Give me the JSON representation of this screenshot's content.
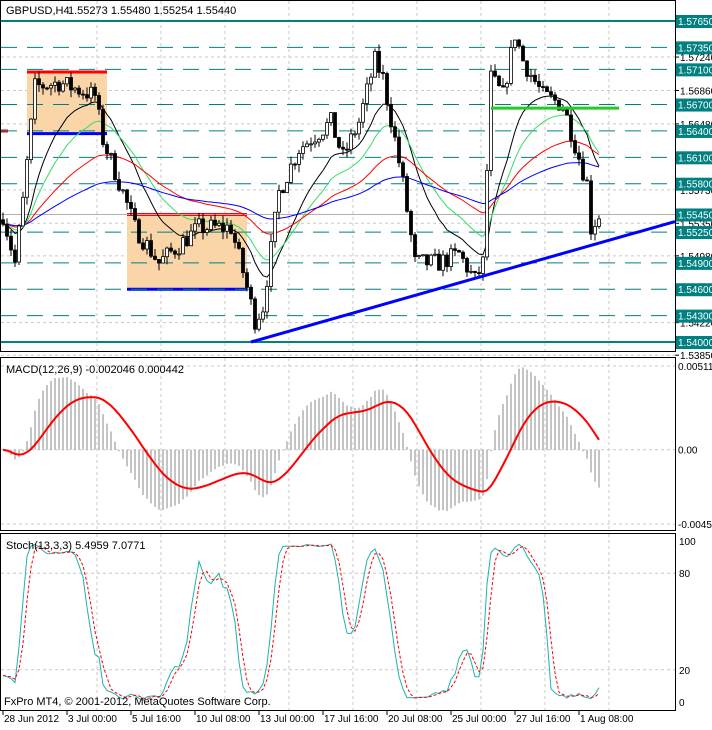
{
  "header": {
    "symbol": "GBPUSD,H4",
    "ohlc": "1.55273 1.55480 1.55254 1.55440"
  },
  "macd_label": "MACD(12,26,9) -0.002046 0.000442",
  "stoch_label": "Stoch(13,3,3) 5.4959 7.0771",
  "copyright": "FxPro MT4, © 2001-2012, MetaQuotes Software Corp.",
  "colors": {
    "level": "#008080",
    "trend": "#0000ff",
    "box": "#fad5a8",
    "box_top": "#ff0000",
    "box_bottom": "#0000ff",
    "green_line": "#22cc22",
    "stoch_main": "#20b2aa",
    "stoch_signal": "#ff0000",
    "macd_signal": "#ff0000",
    "macd_hist": "#b0b0b0"
  },
  "chart_data": {
    "type": "candlestick",
    "title": "GBPUSD,H4",
    "ylim": [
      1.5385,
      1.5778
    ],
    "price_grid_labels": [
      "1.57240",
      "1.56860",
      "1.56480",
      "1.55730",
      "1.55350",
      "1.54980",
      "1.54220",
      "1.53850"
    ],
    "price_grid_values": [
      1.5724,
      1.5686,
      1.5648,
      1.5573,
      1.5535,
      1.5498,
      1.5422,
      1.5385
    ],
    "levels": [
      {
        "label": "1.57650",
        "value": 1.5765,
        "solid": true
      },
      {
        "label": "1.57350",
        "value": 1.5735
      },
      {
        "label": "1.57100",
        "value": 1.571
      },
      {
        "label": "1.56700",
        "value": 1.567
      },
      {
        "label": "1.56400",
        "value": 1.564
      },
      {
        "label": "1.56100",
        "value": 1.561
      },
      {
        "label": "1.55800",
        "value": 1.558
      },
      {
        "label": "1.55450",
        "value": 1.5545
      },
      {
        "label": "1.55250",
        "value": 1.5525
      },
      {
        "label": "1.54900",
        "value": 1.549
      },
      {
        "label": "1.54600",
        "value": 1.546
      },
      {
        "label": "1.54300",
        "value": 1.543
      },
      {
        "label": "1.54000",
        "value": 1.54,
        "solid": true
      }
    ],
    "time_labels": [
      "28 Jun 2012",
      "3 Jul 00:00",
      "5 Jul 16:00",
      "10 Jul 08:00",
      "13 Jul 00:00",
      "17 Jul 16:00",
      "20 Jul 08:00",
      "25 Jul 00:00",
      "27 Jul 16:00",
      "1 Aug 08:00"
    ],
    "bars_per_time_label": 16,
    "bar_count": 150,
    "close_anchors": [
      [
        0,
        1.5545
      ],
      [
        3,
        1.549
      ],
      [
        5,
        1.556
      ],
      [
        8,
        1.569
      ],
      [
        14,
        1.5695
      ],
      [
        23,
        1.568
      ],
      [
        25,
        1.563
      ],
      [
        30,
        1.557
      ],
      [
        33,
        1.553
      ],
      [
        39,
        1.549
      ],
      [
        49,
        1.553
      ],
      [
        57,
        1.553
      ],
      [
        60,
        1.548
      ],
      [
        63,
        1.5425
      ],
      [
        65,
        1.544
      ],
      [
        69,
        1.557
      ],
      [
        74,
        1.562
      ],
      [
        82,
        1.565
      ],
      [
        85,
        1.561
      ],
      [
        89,
        1.565
      ],
      [
        93,
        1.572
      ],
      [
        95,
        1.57
      ],
      [
        98,
        1.563
      ],
      [
        100,
        1.558
      ],
      [
        103,
        1.549
      ],
      [
        109,
        1.549
      ],
      [
        114,
        1.55
      ],
      [
        118,
        1.547
      ],
      [
        120,
        1.549
      ],
      [
        122,
        1.57
      ],
      [
        125,
        1.568
      ],
      [
        128,
        1.575
      ],
      [
        130,
        1.572
      ],
      [
        135,
        1.568
      ],
      [
        140,
        1.567
      ],
      [
        144,
        1.561
      ],
      [
        146,
        1.558
      ],
      [
        147,
        1.553
      ],
      [
        149,
        1.5544
      ]
    ],
    "boxes": [
      {
        "from_bar": 6,
        "to_bar": 26,
        "top": 1.5707,
        "bottom": 1.5637
      },
      {
        "from_bar": 31,
        "to_bar": 61,
        "top": 1.5545,
        "bottom": 1.546
      }
    ],
    "green_line": {
      "from_bar": 122,
      "to_bar": 154,
      "value": 1.5666
    },
    "trendline": {
      "from": [
        62,
        1.54
      ],
      "to": [
        168,
        1.5537
      ]
    },
    "moving_averages": [
      {
        "period": 14,
        "color": "#000000"
      },
      {
        "period": 24,
        "color": "#33dd66"
      },
      {
        "period": 50,
        "color": "#ff0000"
      },
      {
        "period": 100,
        "color": "#0000ff"
      }
    ],
    "macd": {
      "params": [
        12,
        26,
        9
      ],
      "ylim": [
        -0.004534,
        0.005111
      ],
      "tick_labels": [
        "0.005111",
        "0.00",
        "-0.004534"
      ]
    },
    "stoch": {
      "params": [
        13,
        3,
        3
      ],
      "ylim": [
        0,
        100
      ],
      "tick_labels": [
        "100",
        "80",
        "20",
        "0"
      ],
      "tick_values": [
        100,
        80,
        20,
        0
      ]
    }
  }
}
